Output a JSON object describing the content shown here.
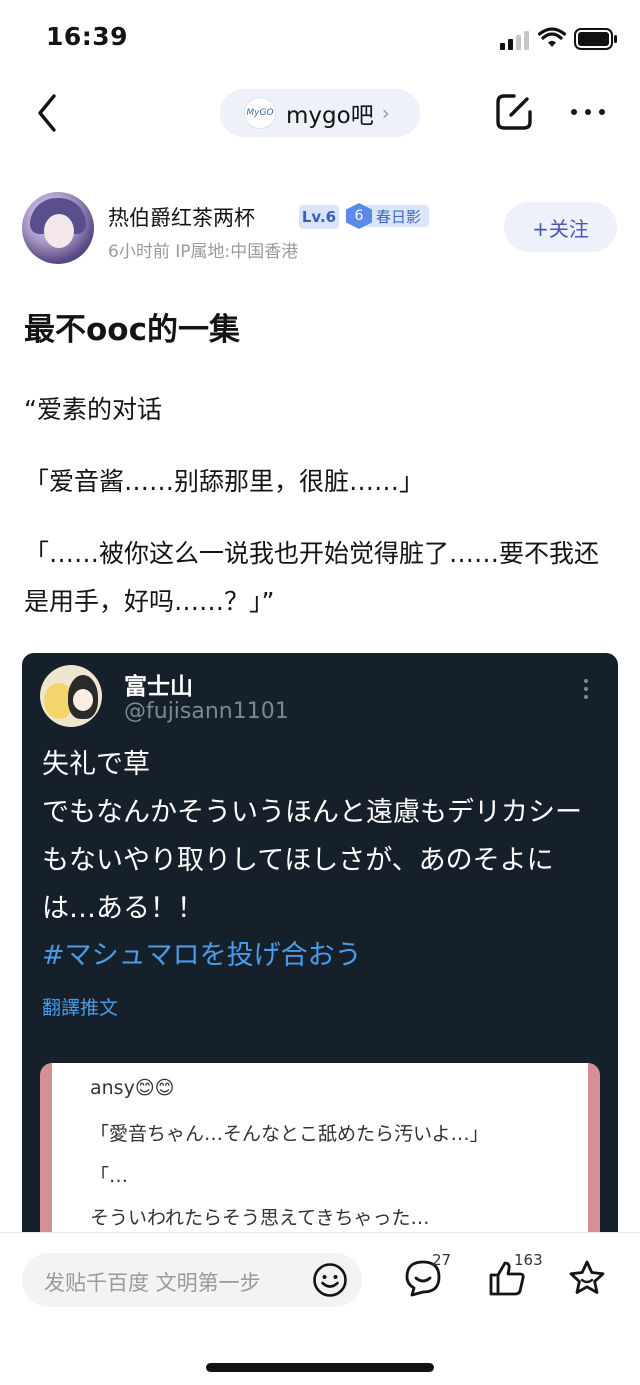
{
  "status": {
    "time": "16:39"
  },
  "nav": {
    "forum_name": "mygo吧",
    "forum_logo_text": "MyGO"
  },
  "author": {
    "name": "热伯爵红茶两杯",
    "level": "Lv.6",
    "badge_num": "6",
    "badge_text": "春日影",
    "meta": "6小时前   IP属地:中国香港",
    "follow_label": "+关注"
  },
  "post": {
    "title": "最不ooc的一集",
    "para1": "“爱素的对话",
    "para2": "「爱音酱……别舔那里，很脏……」",
    "para3": "「……被你这么一说我也开始觉得脏了……要不我还是用手，好吗……？」”"
  },
  "tweet": {
    "name": "富士山",
    "handle": "@fujisann1101",
    "line1": "失礼で草",
    "line2": "でもなんかそういうほんと遠慮もデリカシーもないやり取りしてほしさが、あのそよには…ある！！",
    "hashtag": "#マシュマロを投げ合おう",
    "translate": "翻譯推文",
    "quote_name": "ansy😊😊",
    "quote_line1": "「愛音ちゃん…そんなとこ舐めたら汚いよ…」",
    "quote_line2": "「…",
    "quote_line3": "そういわれたらそう思えてきちゃった…"
  },
  "bottom": {
    "input_placeholder": "发贴千百度 文明第一步",
    "comments": "27",
    "likes": "163"
  }
}
